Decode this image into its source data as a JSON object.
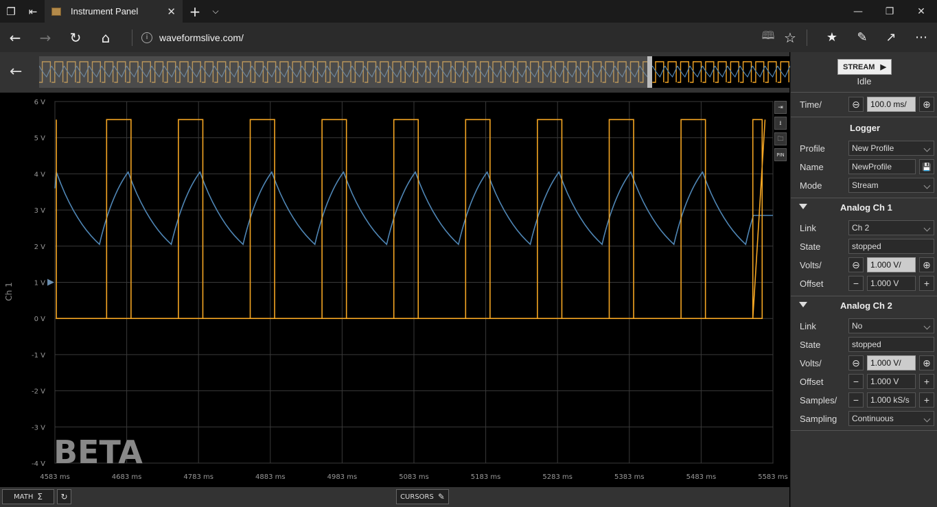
{
  "browser": {
    "tab_title": "Instrument Panel",
    "url": "waveformslive.com/"
  },
  "plot": {
    "y_ticks": [
      "6 V",
      "5 V",
      "4 V",
      "3 V",
      "2 V",
      "1 V",
      "0 V",
      "-1 V",
      "-2 V",
      "-3 V",
      "-4 V"
    ],
    "x_ticks": [
      "4583 ms",
      "4683 ms",
      "4783 ms",
      "4883 ms",
      "4983 ms",
      "5083 ms",
      "5183 ms",
      "5283 ms",
      "5383 ms",
      "5483 ms",
      "5583 ms"
    ],
    "y_axis_label": "Ch 1",
    "watermark": "BETA",
    "side_tool_pin": "PIN",
    "colors": {
      "square": "#f5a623",
      "triangle": "#4f86b5"
    }
  },
  "chart_data": {
    "type": "line",
    "x_label": "",
    "y_label": "Ch 1",
    "xlim": [
      4583,
      5583
    ],
    "ylim": [
      -4,
      6
    ],
    "x_ticks": [
      4583,
      4683,
      4783,
      4883,
      4983,
      5083,
      5183,
      5283,
      5383,
      5483,
      5583
    ],
    "y_ticks": [
      -4,
      -3,
      -2,
      -1,
      0,
      1,
      2,
      3,
      4,
      5,
      6
    ],
    "grid": true,
    "offset_marker": 1,
    "series": [
      {
        "color": "#f5a623",
        "shape": "square",
        "period_ms": 100,
        "high": 5.5,
        "low": 0,
        "rises": [
          4589,
          4689,
          4789,
          4889,
          4989,
          5089,
          5189,
          5289,
          5389,
          5489,
          5589
        ],
        "falls": [
          4585,
          4655,
          4755,
          4855,
          4955,
          5055,
          5155,
          5255,
          5355,
          5455,
          5555
        ]
      },
      {
        "color": "#4f86b5",
        "shape": "exponential-sawtooth",
        "period_ms": 100,
        "peak": 4.05,
        "trough": 2.05,
        "peaks": [
          4585,
          4685,
          4785,
          4885,
          4985,
          5085,
          5185,
          5285,
          5385,
          5485
        ],
        "troughs": [
          4645,
          4745,
          4845,
          4945,
          5045,
          5145,
          5245,
          5345,
          5445,
          5545
        ]
      }
    ]
  },
  "bottom": {
    "math_label": "MATH",
    "cursors_label": "CURSORS"
  },
  "panel": {
    "stream_label": "STREAM",
    "status": "Idle",
    "time_label": "Time/",
    "time_value": "100.0 ms/",
    "logger_title": "Logger",
    "profile_label": "Profile",
    "profile_value": "New Profile",
    "name_label": "Name",
    "name_value": "NewProfile",
    "mode_label": "Mode",
    "mode_value": "Stream",
    "ch1_title": "Analog Ch 1",
    "ch1_link_label": "Link",
    "ch1_link_value": "Ch 2",
    "ch1_state_label": "State",
    "ch1_state_value": "stopped",
    "ch1_volts_label": "Volts/",
    "ch1_volts_value": "1.000 V/",
    "ch1_offset_label": "Offset",
    "ch1_offset_value": "1.000 V",
    "ch2_title": "Analog Ch 2",
    "ch2_link_label": "Link",
    "ch2_link_value": "No",
    "ch2_state_label": "State",
    "ch2_state_value": "stopped",
    "ch2_volts_label": "Volts/",
    "ch2_volts_value": "1.000 V/",
    "ch2_offset_label": "Offset",
    "ch2_offset_value": "1.000 V",
    "ch2_samples_label": "Samples/",
    "ch2_samples_value": "1.000 kS/s",
    "ch2_sampling_label": "Sampling",
    "ch2_sampling_value": "Continuous"
  }
}
